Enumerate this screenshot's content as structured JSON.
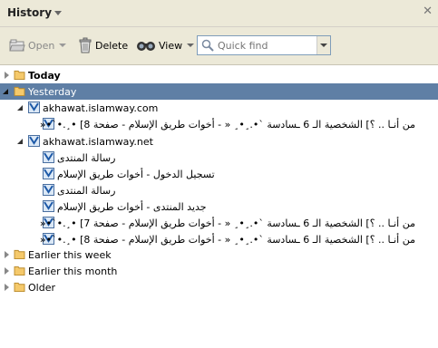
{
  "panel": {
    "title": "History"
  },
  "toolbar": {
    "open_label": "Open",
    "delete_label": "Delete",
    "view_label": "View",
    "search_placeholder": "Quick find"
  },
  "tree": {
    "groups": [
      {
        "label": "Today",
        "expanded": false,
        "selected": false
      },
      {
        "label": "Yesterday",
        "expanded": true,
        "selected": true
      },
      {
        "label": "Earlier this week",
        "expanded": false,
        "selected": false
      },
      {
        "label": "Earlier this month",
        "expanded": false,
        "selected": false
      },
      {
        "label": "Older",
        "expanded": false,
        "selected": false
      }
    ],
    "sites": [
      {
        "label": "akhawat.islamway.com",
        "pages": [
          {
            "title": "من أنـا .. ؟] الشخصية الـ 6 ـسادسة `•.¸•¸ « - أخوات طريق الإسلام - صفحة 8] •¸.•`•« "
          }
        ]
      },
      {
        "label": "akhawat.islamway.net",
        "pages": [
          {
            "title": "رسالة المنتدى"
          },
          {
            "title": "تسجيل الدخول - أخوات طريق الإسلام"
          },
          {
            "title": "رسالة المنتدى"
          },
          {
            "title": "جديد المنتدى - أخوات طريق الإسلام"
          },
          {
            "title": "من أنـا .. ؟] الشخصية الـ 6 ـسادسة `•.¸•¸ « - أخوات طريق الإسلام - صفحة 7] •¸.•`•« "
          },
          {
            "title": "من أنـا .. ؟] الشخصية الـ 6 ـسادسة `•.¸•¸ « - أخوات طريق الإسلام - صفحة 8] •¸.•`•« "
          }
        ]
      }
    ]
  },
  "colors": {
    "selected_row": "#5f7fa5",
    "toolbar_bg": "#ece9d8",
    "folder_fill": "#f5c96b"
  }
}
